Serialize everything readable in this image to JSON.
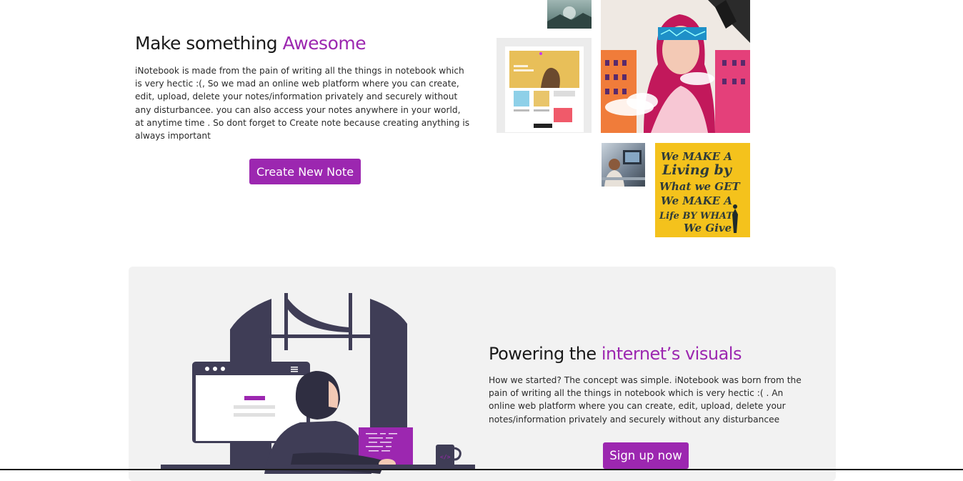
{
  "hero": {
    "title_prefix": "Make something ",
    "title_accent": "Awesome",
    "description": "iNotebook is made from the pain of writing all the things in notebook which is very hectic :(, So we mad an online web platform where you can create, edit, upload, delete your notes/information privately and securely without any disturbancee. you can also access your notes anywhere in your world, at anytime time . So dont forget to Create note because creating anything is always important",
    "cta_label": "Create New Note"
  },
  "collage": {
    "poster_lines": [
      "We MAKE A",
      "Living by",
      "What we GET",
      "We MAKE A",
      "Life BY WHAT",
      "We Give"
    ]
  },
  "powering": {
    "title_prefix": "Powering the ",
    "title_accent": "internet’s visuals",
    "description": "How we started? The concept was simple. iNotebook was born from the pain of writing all the things in notebook which is very hectic :( . An online web platform where you can create, edit, upload, delete your notes/information privately and securely without any disturbancee",
    "cta_label": "Sign up now"
  },
  "colors": {
    "accent": "#9c27b0",
    "panel_bg": "#f2f2f2",
    "illustration_dark": "#3f3d56"
  }
}
